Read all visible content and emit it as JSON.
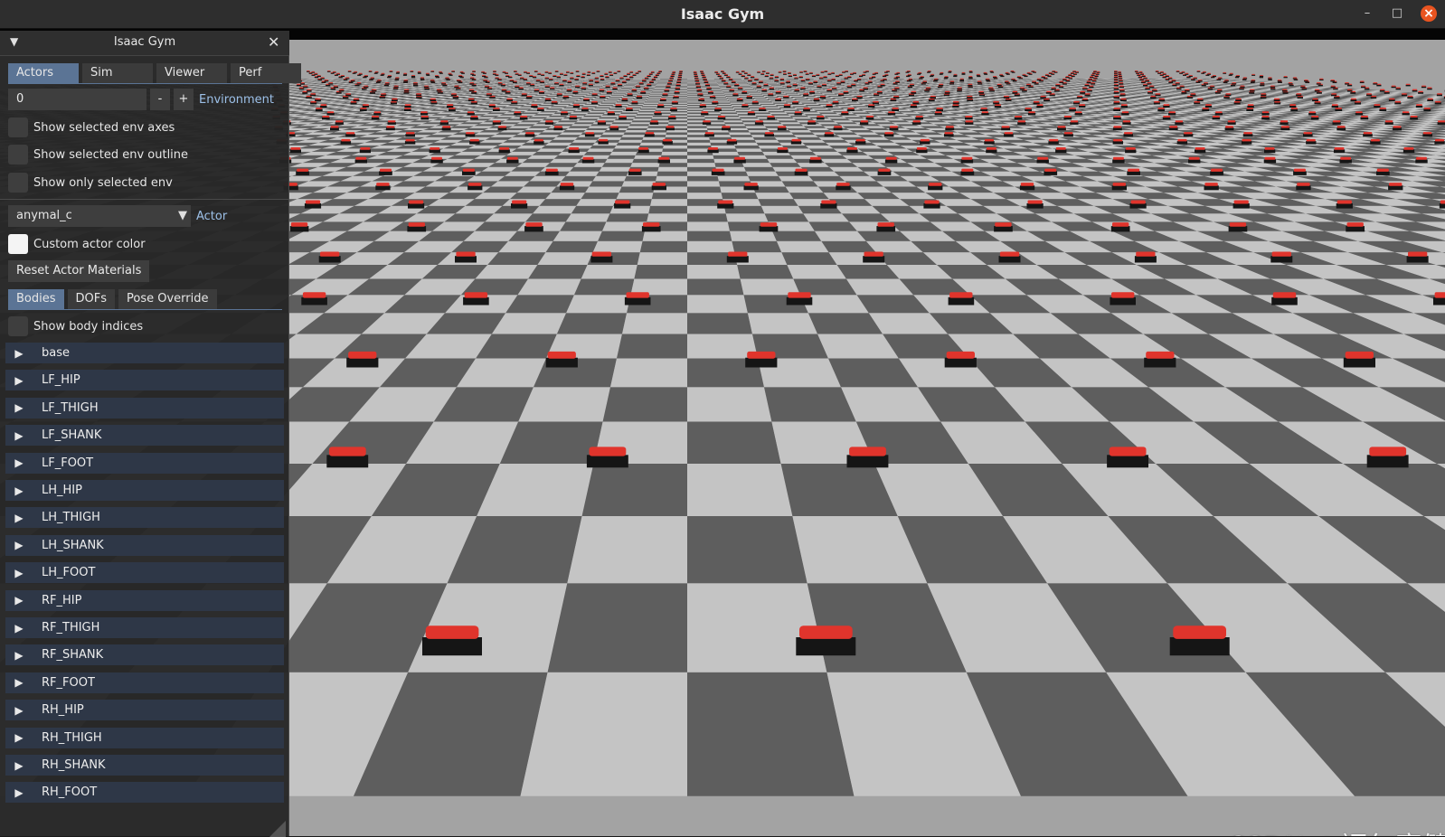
{
  "window": {
    "title": "Isaac Gym",
    "min_glyph": "–",
    "max_glyph": "□",
    "close_glyph": "×"
  },
  "panel": {
    "title": "Isaac Gym",
    "collapse_glyph": "▼",
    "close_glyph": "✕",
    "tabs": [
      "Actors",
      "Sim",
      "Viewer",
      "Perf"
    ],
    "active_tab": "Actors",
    "environment": {
      "value": "0",
      "minus": "-",
      "plus": "+",
      "label": "Environment"
    },
    "env_options": [
      {
        "label": "Show selected env axes",
        "checked": false
      },
      {
        "label": "Show selected env outline",
        "checked": false
      },
      {
        "label": "Show only selected env",
        "checked": false
      }
    ],
    "actor": {
      "selected": "anymal_c",
      "arrow": "▼",
      "label": "Actor"
    },
    "custom_actor_color": {
      "label": "Custom actor color",
      "swatch": "#f4f4f4"
    },
    "reset_button": "Reset Actor Materials",
    "sub_tabs": [
      "Bodies",
      "DOFs",
      "Pose Override"
    ],
    "active_sub_tab": "Bodies",
    "show_body_indices": {
      "label": "Show body indices",
      "checked": false
    },
    "bodies": [
      "base",
      "LF_HIP",
      "LF_THIGH",
      "LF_SHANK",
      "LF_FOOT",
      "LH_HIP",
      "LH_THIGH",
      "LH_SHANK",
      "LH_FOOT",
      "RF_HIP",
      "RF_THIGH",
      "RF_SHANK",
      "RF_FOOT",
      "RH_HIP",
      "RH_THIGH",
      "RH_SHANK",
      "RH_FOOT"
    ],
    "expand_glyph": "▶"
  },
  "viewport": {
    "floor_light": "#c4c4c4",
    "floor_dark": "#5e5e5e",
    "robot_color": "#e0342c",
    "robot_dark": "#151515",
    "watermark": "CSDN @福尔摩健"
  }
}
